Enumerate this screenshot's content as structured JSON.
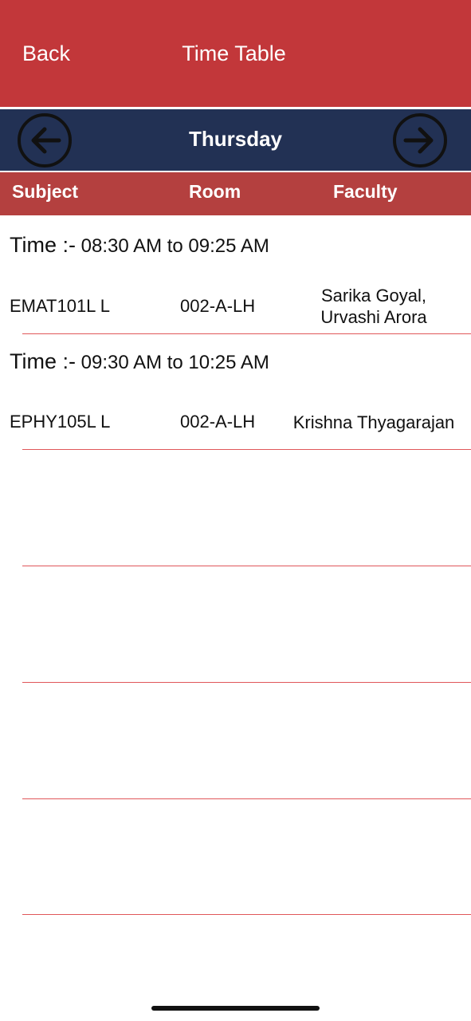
{
  "nav": {
    "back_label": "Back",
    "title": "Time Table"
  },
  "day": {
    "name": "Thursday",
    "prev_icon": "arrow-left-circle-icon",
    "next_icon": "arrow-right-circle-icon"
  },
  "columns": {
    "subject": "Subject",
    "room": "Room",
    "faculty": "Faculty"
  },
  "colors": {
    "topbar": "#c2373a",
    "day_bar": "#223154",
    "header_row": "#b4403f",
    "separator": "#e0575a"
  },
  "slots": [
    {
      "time_prefix": "Time :-",
      "time_range": "08:30 AM to 09:25 AM",
      "subject": "EMAT101L  L",
      "room": "002-A-LH",
      "faculty_line1": "Sarika Goyal,",
      "faculty_line2": "Urvashi Arora"
    },
    {
      "time_prefix": "Time :-",
      "time_range": "09:30 AM to 10:25 AM",
      "subject": "EPHY105L  L",
      "room": "002-A-LH",
      "faculty_line1": "Krishna Thyagarajan",
      "faculty_line2": ""
    }
  ]
}
